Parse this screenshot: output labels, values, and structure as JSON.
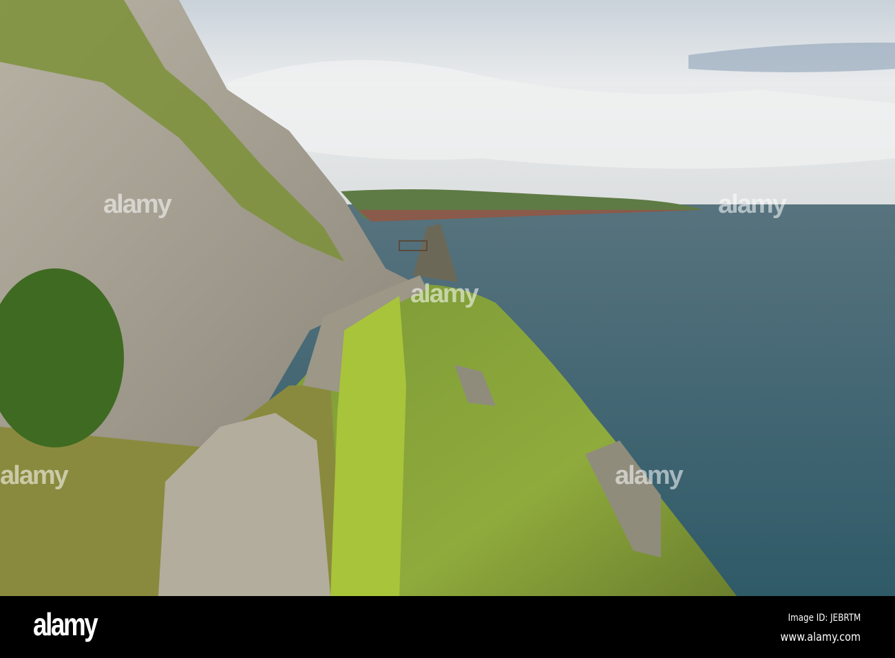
{
  "watermark": {
    "logo": "alamy"
  },
  "footer": {
    "logo": "alamy",
    "image_id": "Image ID: JEBRTM",
    "site": "www.alamy.com"
  },
  "colors": {
    "sea": "#3e6470",
    "sky": "#dfe3e6",
    "grass": "#7a9a2e",
    "rock": "#a9a495"
  }
}
